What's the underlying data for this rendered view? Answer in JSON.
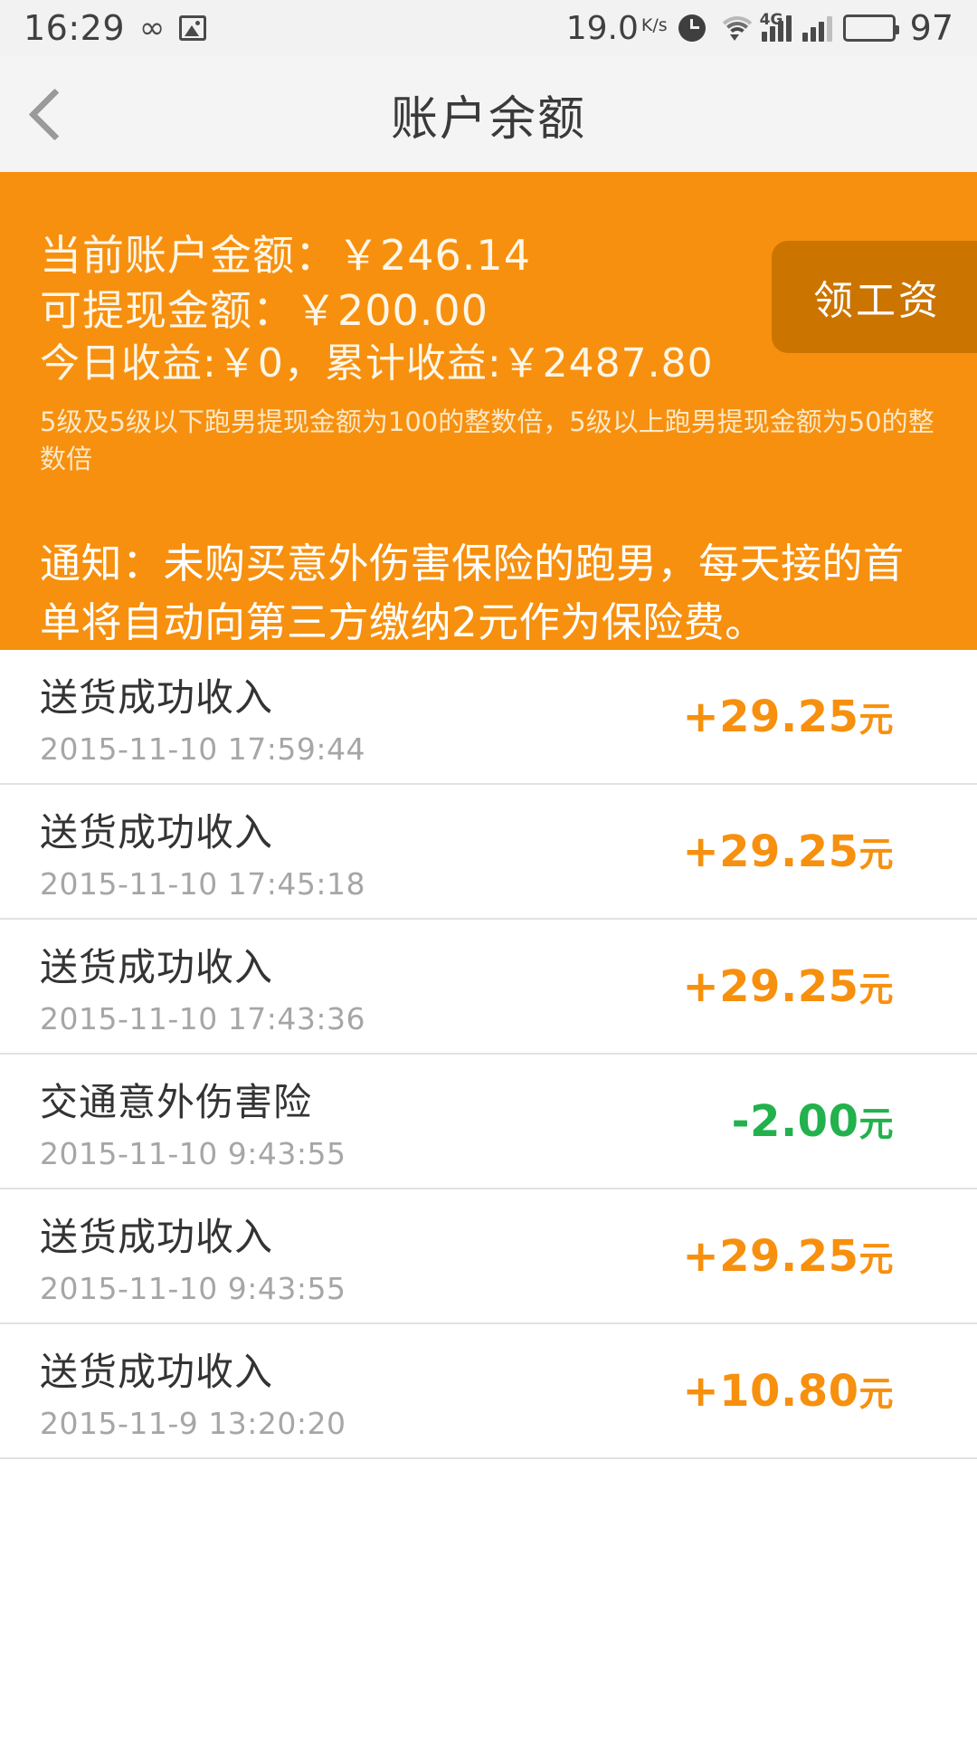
{
  "statusbar": {
    "time": "16:29",
    "network_speed": "19.0",
    "speed_unit": "K/s",
    "battery_level": "97",
    "icons": [
      "infinity-icon",
      "gallery-icon",
      "alarm-icon",
      "wifi-icon",
      "signal-4g-icon",
      "signal-2-icon",
      "battery-icon"
    ]
  },
  "header": {
    "title": "账户余额",
    "back_icon": "chevron-left-icon"
  },
  "card": {
    "accent_color": "#f7900e",
    "button_color": "#cc7400",
    "current_balance_line": "当前账户金额：￥246.14",
    "withdrawable_line": "可提现金额：￥200.00",
    "earnings_line": "今日收益:￥0，累计收益:￥2487.80",
    "current_balance_value": "246.14",
    "withdrawable_value": "200.00",
    "today_earnings_value": "0",
    "total_earnings_value": "2487.80",
    "rule_text": "5级及5级以下跑男提现金额为100的整数倍，5级以上跑男提现金额为50的整数倍",
    "salary_button_label": "领工资",
    "notice_text": "通知：未购买意外伤害保险的跑男，每天接的首单将自动向第三方缴纳2元作为保险费。"
  },
  "transactions": {
    "positive_color": "#f7900e",
    "negative_color": "#22b14c",
    "rows": [
      {
        "title": "送货成功收入",
        "date": "2015-11-10 17:59:44",
        "amount": "+29.25",
        "unit": "元",
        "sign": "pos"
      },
      {
        "title": "送货成功收入",
        "date": "2015-11-10 17:45:18",
        "amount": "+29.25",
        "unit": "元",
        "sign": "pos"
      },
      {
        "title": "送货成功收入",
        "date": "2015-11-10 17:43:36",
        "amount": "+29.25",
        "unit": "元",
        "sign": "pos"
      },
      {
        "title": "交通意外伤害险",
        "date": "2015-11-10 9:43:55",
        "amount": "-2.00",
        "unit": "元",
        "sign": "neg"
      },
      {
        "title": "送货成功收入",
        "date": "2015-11-10 9:43:55",
        "amount": "+29.25",
        "unit": "元",
        "sign": "pos"
      },
      {
        "title": "送货成功收入",
        "date": "2015-11-9 13:20:20",
        "amount": "+10.80",
        "unit": "元",
        "sign": "pos"
      }
    ]
  }
}
